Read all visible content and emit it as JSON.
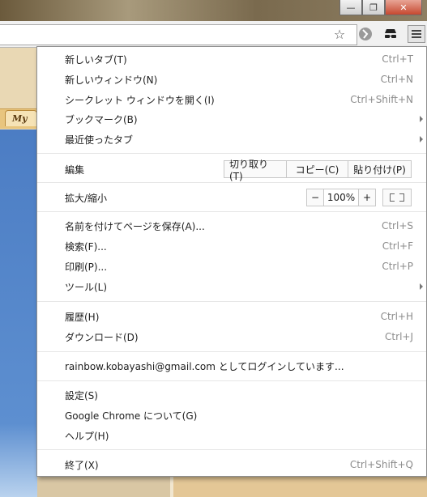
{
  "window": {
    "minimize_glyph": "—",
    "restore_glyph": "❐",
    "close_glyph": "✕"
  },
  "toolbar": {
    "icons": [
      "bookmark-star-icon",
      "extension-icon",
      "incognito-icon",
      "chrome-menu-icon"
    ]
  },
  "background_page": {
    "tab_label": "My"
  },
  "menu": {
    "group1": [
      {
        "label": "新しいタブ(T)",
        "shortcut": "Ctrl+T"
      },
      {
        "label": "新しいウィンドウ(N)",
        "shortcut": "Ctrl+N"
      },
      {
        "label": "シークレット ウィンドウを開く(I)",
        "shortcut": "Ctrl+Shift+N"
      },
      {
        "label": "ブックマーク(B)",
        "submenu": true
      },
      {
        "label": "最近使ったタブ",
        "submenu": true
      }
    ],
    "edit": {
      "label": "編集",
      "cut": "切り取り(T)",
      "copy": "コピー(C)",
      "paste": "貼り付け(P)"
    },
    "zoom": {
      "label": "拡大/縮小",
      "minus": "−",
      "value": "100%",
      "plus": "+"
    },
    "group2": [
      {
        "label": "名前を付けてページを保存(A)...",
        "shortcut": "Ctrl+S"
      },
      {
        "label": "検索(F)...",
        "shortcut": "Ctrl+F"
      },
      {
        "label": "印刷(P)...",
        "shortcut": "Ctrl+P"
      },
      {
        "label": "ツール(L)",
        "submenu": true
      }
    ],
    "group3": [
      {
        "label": "履歴(H)",
        "shortcut": "Ctrl+H"
      },
      {
        "label": "ダウンロード(D)",
        "shortcut": "Ctrl+J"
      }
    ],
    "signin": "rainbow.kobayashi@gmail.com としてログインしています...",
    "group4": [
      {
        "label": "設定(S)"
      },
      {
        "label": "Google Chrome について(G)"
      },
      {
        "label": "ヘルプ(H)"
      }
    ],
    "exit": {
      "label": "終了(X)",
      "shortcut": "Ctrl+Shift+Q"
    }
  }
}
